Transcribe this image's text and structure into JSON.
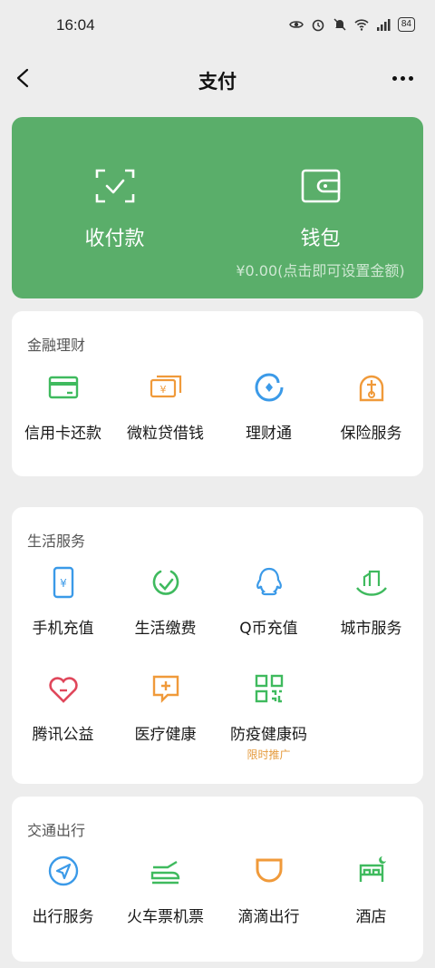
{
  "status_bar": {
    "time": "16:04",
    "battery": "84"
  },
  "nav": {
    "title": "支付"
  },
  "hero": {
    "pay": {
      "label": "收付款",
      "icon": "scan-check-icon"
    },
    "wallet": {
      "label": "钱包",
      "sub": "¥0.00(点击即可设置金额)",
      "icon": "wallet-icon"
    }
  },
  "sections": {
    "finance": {
      "title": "金融理财",
      "items": [
        {
          "label": "信用卡还款",
          "icon": "credit-card-icon"
        },
        {
          "label": "微粒贷借钱",
          "icon": "loan-icon"
        },
        {
          "label": "理财通",
          "icon": "wealth-icon"
        },
        {
          "label": "保险服务",
          "icon": "insurance-icon"
        }
      ]
    },
    "life": {
      "title": "生活服务",
      "items": [
        {
          "label": "手机充值",
          "icon": "phone-topup-icon"
        },
        {
          "label": "生活缴费",
          "icon": "utility-bill-icon"
        },
        {
          "label": "Q币充值",
          "icon": "qq-coin-icon"
        },
        {
          "label": "城市服务",
          "icon": "city-service-icon"
        },
        {
          "label": "腾讯公益",
          "icon": "charity-icon"
        },
        {
          "label": "医疗健康",
          "icon": "medical-icon"
        },
        {
          "label": "防疫健康码",
          "sub": "限时推广",
          "icon": "health-qr-icon"
        }
      ]
    },
    "travel": {
      "title": "交通出行",
      "items": [
        {
          "label": "出行服务",
          "icon": "travel-service-icon"
        },
        {
          "label": "火车票机票",
          "icon": "train-plane-icon"
        },
        {
          "label": "滴滴出行",
          "icon": "didi-icon"
        },
        {
          "label": "酒店",
          "icon": "hotel-icon"
        }
      ]
    }
  },
  "colors": {
    "hero_green": "#5aae6a",
    "icon_green": "#3fba5e",
    "icon_orange": "#f09a3a",
    "icon_blue": "#3b9ae8",
    "icon_red": "#e0475b",
    "promo_orange": "#e59a3c"
  }
}
